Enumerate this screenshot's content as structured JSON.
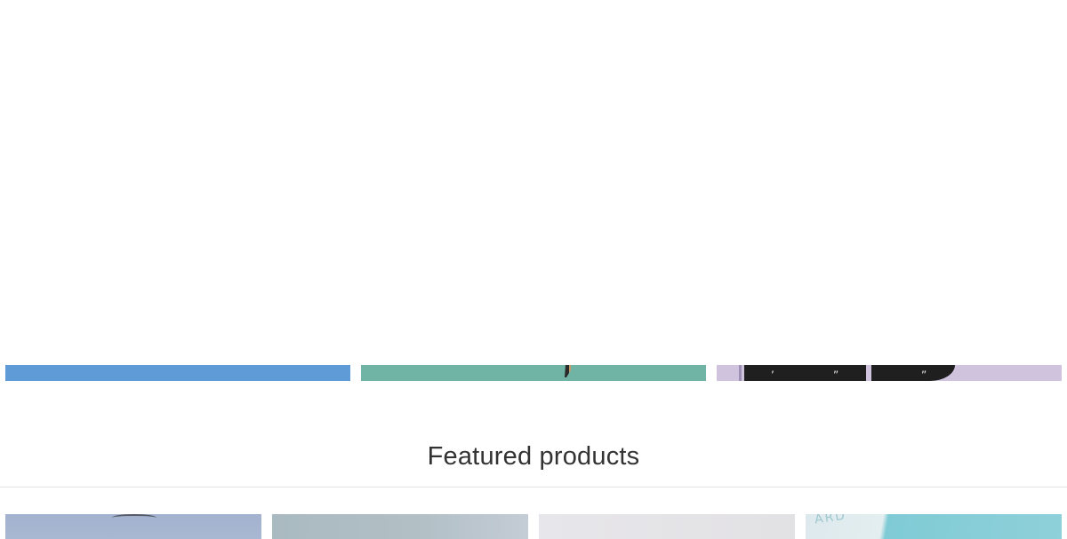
{
  "featured": {
    "title": "Featured products"
  },
  "banners": [
    {
      "name": "banner-blue",
      "color": "#5f9bd6"
    },
    {
      "name": "banner-teal",
      "color": "#6fb4a5"
    },
    {
      "name": "banner-lavender",
      "color": "#d0c3de"
    }
  ],
  "products": [
    {
      "name": "product-1",
      "color": "#a3b2cf"
    },
    {
      "name": "product-2",
      "color": "#b3c0c6"
    },
    {
      "name": "product-3",
      "color": "#e4e3e7"
    },
    {
      "name": "product-4",
      "color": "#8fd0da"
    }
  ]
}
